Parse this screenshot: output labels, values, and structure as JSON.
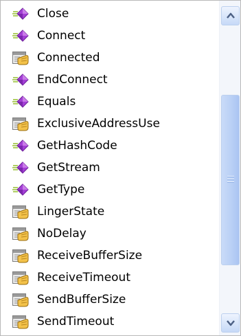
{
  "members": [
    {
      "label": "Close",
      "icon": "method-icon"
    },
    {
      "label": "Connect",
      "icon": "method-icon"
    },
    {
      "label": "Connected",
      "icon": "property-icon"
    },
    {
      "label": "EndConnect",
      "icon": "method-icon"
    },
    {
      "label": "Equals",
      "icon": "method-icon"
    },
    {
      "label": "ExclusiveAddressUse",
      "icon": "property-icon"
    },
    {
      "label": "GetHashCode",
      "icon": "method-icon"
    },
    {
      "label": "GetStream",
      "icon": "method-icon"
    },
    {
      "label": "GetType",
      "icon": "method-icon"
    },
    {
      "label": "LingerState",
      "icon": "property-icon"
    },
    {
      "label": "NoDelay",
      "icon": "property-icon"
    },
    {
      "label": "ReceiveBufferSize",
      "icon": "property-icon"
    },
    {
      "label": "ReceiveTimeout",
      "icon": "property-icon"
    },
    {
      "label": "SendBufferSize",
      "icon": "property-icon"
    },
    {
      "label": "SendTimeout",
      "icon": "property-icon"
    }
  ],
  "colors": {
    "method_purple": "#a43fd6",
    "property_hand": "#f3c24a",
    "scrollbar_blue": "#b8cff5"
  }
}
